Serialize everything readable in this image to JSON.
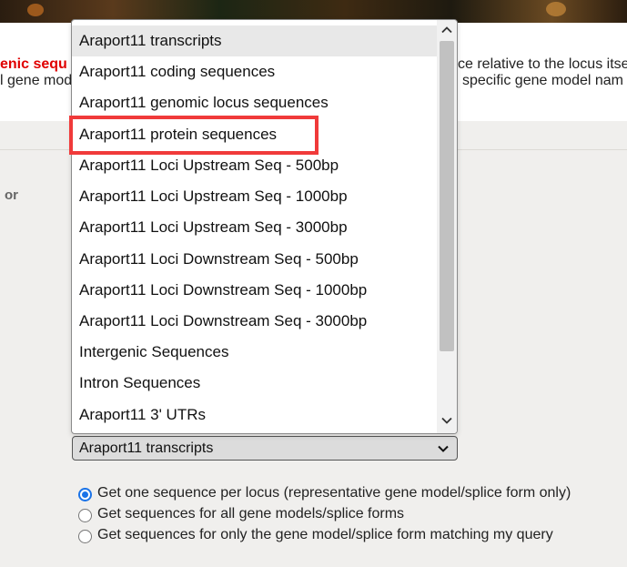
{
  "intro": {
    "line1_red": "enic sequ",
    "line1_right": "ce relative to the locus itse",
    "line2_left": "l gene mod",
    "line2_right": "specific gene model nam"
  },
  "or_label": "or",
  "dropdown": {
    "options": [
      "Araport11 transcripts",
      "Araport11 coding sequences",
      "Araport11 genomic locus sequences",
      "Araport11 protein sequences",
      "Araport11 Loci Upstream Seq - 500bp",
      "Araport11 Loci Upstream Seq - 1000bp",
      "Araport11 Loci Upstream Seq - 3000bp",
      "Araport11 Loci Downstream Seq - 500bp",
      "Araport11 Loci Downstream Seq - 1000bp",
      "Araport11 Loci Downstream Seq - 3000bp",
      "Intergenic Sequences",
      "Intron Sequences",
      "Araport11 3' UTRs"
    ],
    "selected_value": "Araport11 transcripts"
  },
  "radios": [
    {
      "label": "Get one sequence per locus (representative gene model/splice form only)",
      "checked": true
    },
    {
      "label": "Get sequences for all gene models/splice forms",
      "checked": false
    },
    {
      "label": "Get sequences for only the gene model/splice form matching my query",
      "checked": false
    }
  ],
  "colors": {
    "accent": "#1a73e8",
    "highlight": "#f03a3a",
    "red_text": "#e00000"
  }
}
